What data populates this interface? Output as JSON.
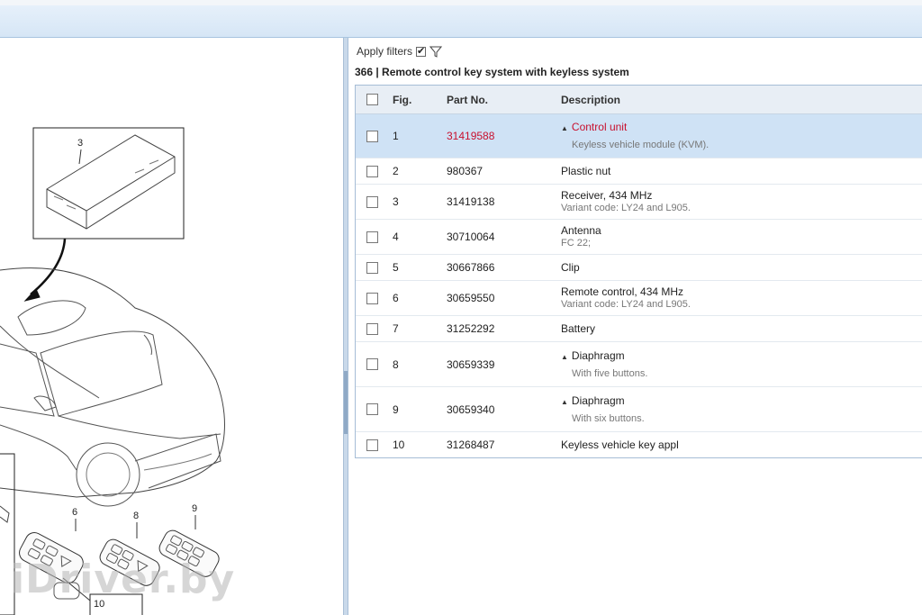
{
  "filters": {
    "label": "Apply filters",
    "checked": true
  },
  "group": {
    "title": "366  |  Remote control key system with keyless system"
  },
  "table": {
    "headers": {
      "fig": "Fig.",
      "part": "Part No.",
      "desc": "Description"
    },
    "rows": [
      {
        "fig": "1",
        "part": "31419588",
        "desc": "Control unit",
        "sub": "Keyless vehicle module (KVM).",
        "collapsible": true,
        "selected": true
      },
      {
        "fig": "2",
        "part": "980367",
        "desc": "Plastic nut",
        "sub": ""
      },
      {
        "fig": "3",
        "part": "31419138",
        "desc": "Receiver, 434 MHz",
        "sub": "Variant code: LY24 and L905."
      },
      {
        "fig": "4",
        "part": "30710064",
        "desc": "Antenna",
        "sub": "FC 22;"
      },
      {
        "fig": "5",
        "part": "30667866",
        "desc": "Clip",
        "sub": ""
      },
      {
        "fig": "6",
        "part": "30659550",
        "desc": "Remote control, 434 MHz",
        "sub": "Variant code: LY24 and L905."
      },
      {
        "fig": "7",
        "part": "31252292",
        "desc": "Battery",
        "sub": ""
      },
      {
        "fig": "8",
        "part": "30659339",
        "desc": "Diaphragm",
        "sub": "With five buttons.",
        "collapsible": true
      },
      {
        "fig": "9",
        "part": "30659340",
        "desc": "Diaphragm",
        "sub": "With six buttons.",
        "collapsible": true
      },
      {
        "fig": "10",
        "part": "31268487",
        "desc": "Keyless vehicle key appl",
        "sub": ""
      }
    ]
  },
  "diagram": {
    "callouts": [
      "3",
      "6",
      "8",
      "9",
      "10"
    ]
  },
  "watermark": "iDriver.by",
  "icons": {
    "filter": "funnel-icon",
    "collapse": "triangle-down-icon"
  }
}
